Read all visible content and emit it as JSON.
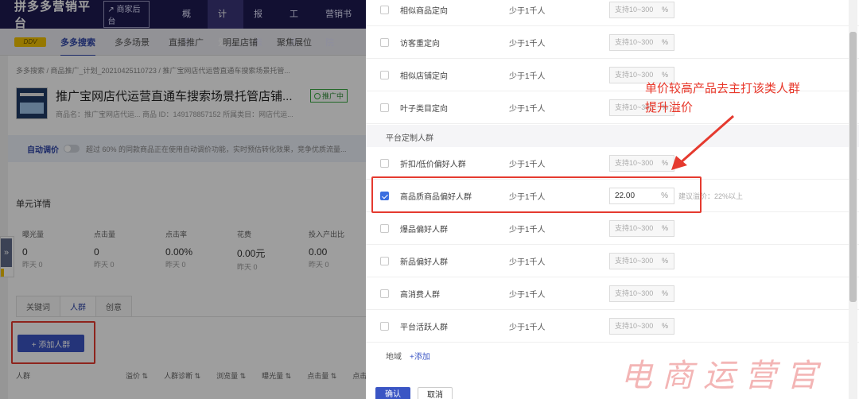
{
  "header": {
    "brand": "拼多多营销平台",
    "merchant_link": "商家后台",
    "nav": [
      {
        "label": "概况"
      },
      {
        "label": "计划",
        "active": true
      },
      {
        "label": "报表"
      },
      {
        "label": "工具"
      },
      {
        "label": "营销书院"
      }
    ]
  },
  "subnav": {
    "logo_text": "DDV",
    "items": [
      {
        "label": "多多搜索",
        "active": true
      },
      {
        "label": "多多场景"
      },
      {
        "label": "直播推广"
      },
      {
        "label": "明星店铺"
      },
      {
        "label": "聚焦展位"
      }
    ]
  },
  "plan": {
    "breadcrumb": "多多搜索 / 商品推广_计划_20210425110723 / 推广宝网店代运营直通车搜索场景托管...",
    "title": "推广宝网店代运营直通车搜索场景托管店铺...",
    "status": "推广中",
    "meta": "商品名：推广宝网店代运... 商品 ID：149178857152 所属类目：网店代运..."
  },
  "autobid": {
    "label": "自动调价",
    "text": "超过 60% 的同款商品正在使用自动调价功能，实时预估转化效果，竞争优质流量..."
  },
  "unit": {
    "title": "单元详情",
    "metrics": [
      {
        "label": "曝光量",
        "value": "0",
        "yesterday": "昨天 0"
      },
      {
        "label": "点击量",
        "value": "0",
        "yesterday": "昨天 0"
      },
      {
        "label": "点击率",
        "value": "0.00%",
        "yesterday": "昨天 0"
      },
      {
        "label": "花费",
        "value": "0.00元",
        "yesterday": "昨天 0"
      },
      {
        "label": "投入产出比",
        "value": "0.00",
        "yesterday": "昨天 0"
      }
    ],
    "tabs": [
      {
        "label": "关键词"
      },
      {
        "label": "人群",
        "active": true
      },
      {
        "label": "创意"
      }
    ],
    "add_button": "+ 添加人群",
    "table_headers": [
      "人群",
      "溢价 ⇅",
      "人群诊断 ⇅",
      "浏览量 ⇅",
      "曝光量 ⇅",
      "点击量 ⇅",
      "点击..."
    ]
  },
  "drawer": {
    "rows_top": [
      {
        "name": "相似商品定向",
        "population": "少于1千人",
        "placeholder": "支持10~300"
      },
      {
        "name": "访客重定向",
        "population": "少于1千人",
        "placeholder": "支持10~300"
      },
      {
        "name": "相似店铺定向",
        "population": "少于1千人",
        "placeholder": "支持10~300"
      },
      {
        "name": "叶子类目定向",
        "population": "少于1千人",
        "placeholder": "支持10~300"
      }
    ],
    "section_label": "平台定制人群",
    "rows_bottom": [
      {
        "name": "折扣/低价偏好人群",
        "population": "少于1千人",
        "placeholder": "支持10~300"
      },
      {
        "name": "高品质商品偏好人群",
        "population": "少于1千人",
        "value": "22.00",
        "checked": true,
        "hint": "建议溢价：22%以上"
      },
      {
        "name": "爆品偏好人群",
        "population": "少于1千人",
        "placeholder": "支持10~300"
      },
      {
        "name": "新品偏好人群",
        "population": "少于1千人",
        "placeholder": "支持10~300"
      },
      {
        "name": "高消费人群",
        "population": "少于1千人",
        "placeholder": "支持10~300"
      },
      {
        "name": "平台活跃人群",
        "population": "少于1千人",
        "placeholder": "支持10~300"
      }
    ],
    "percent": "%",
    "region_label": "地域",
    "region_add": "+添加",
    "ok": "确认",
    "cancel": "取消"
  },
  "annotation": {
    "line1": "单价较高产品去主打该类人群",
    "line2": "提升溢价"
  },
  "watermark": "电商运营官",
  "colors": {
    "topbar": "#1d1a52",
    "primary": "#3a55c4",
    "annotation_red": "#e8372a"
  }
}
